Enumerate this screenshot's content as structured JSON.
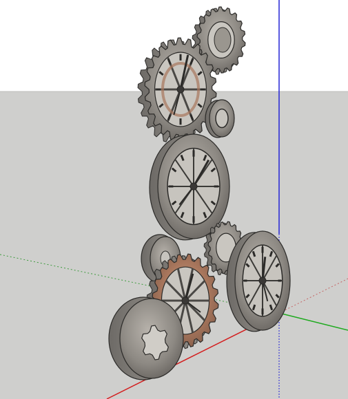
{
  "viewport": {
    "sky_color": "#ffffff",
    "ground_color": "#cfcfcd",
    "horizon_line_color": "#bdbdbb"
  },
  "axes": {
    "blue_color": "#2323d6",
    "red_color": "#d31f1f",
    "green_color": "#1faa1f",
    "dotted_green_color": "#3c9a3c",
    "dotted_red_color": "#c46464"
  },
  "model": {
    "name": "steampunk-gear-clock-assembly",
    "metal_color": "#8d8983",
    "metal_dark": "#5e5b57",
    "metal_light": "#b3afa8",
    "rust_color": "#a8765c",
    "outline_color": "#2b2a28"
  }
}
